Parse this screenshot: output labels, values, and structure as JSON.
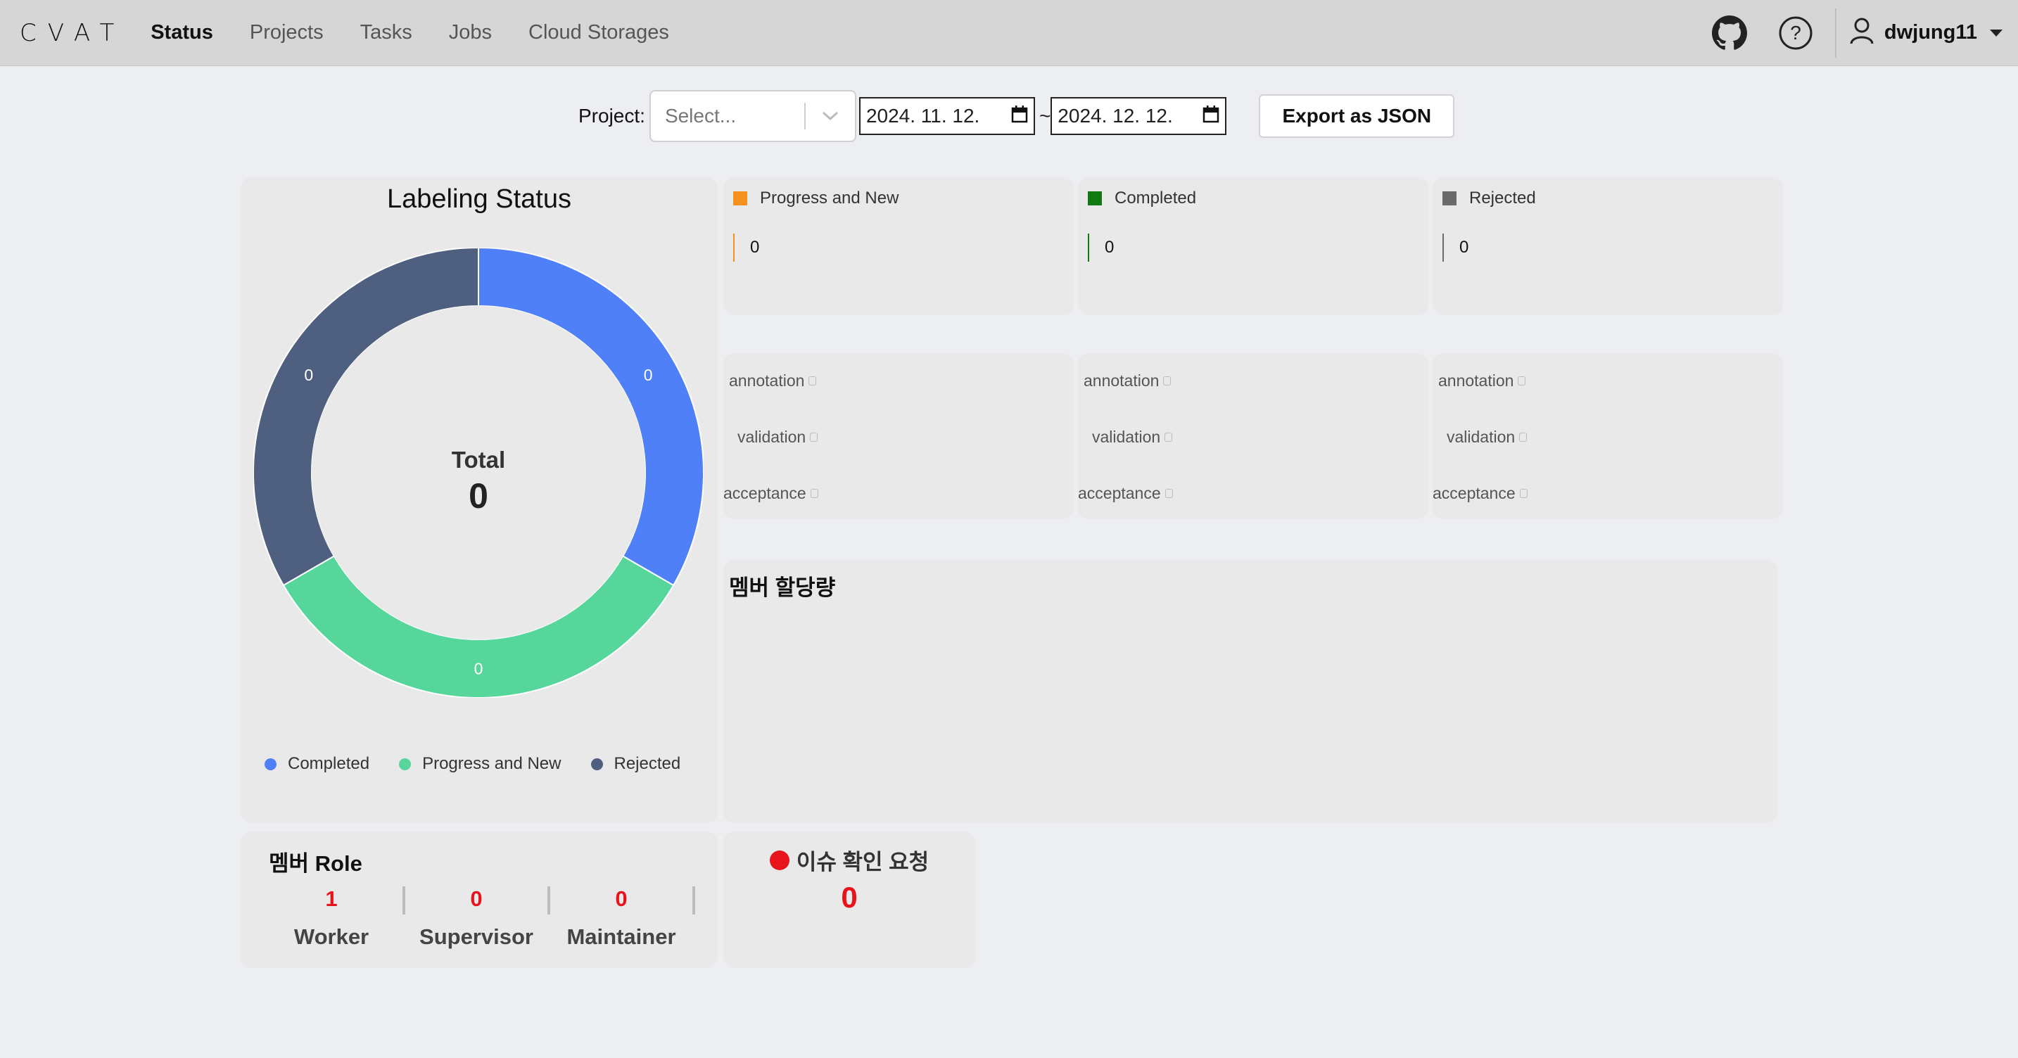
{
  "header": {
    "logo": "CVAT",
    "nav": [
      {
        "label": "Status",
        "active": true
      },
      {
        "label": "Projects",
        "active": false
      },
      {
        "label": "Tasks",
        "active": false
      },
      {
        "label": "Jobs",
        "active": false
      },
      {
        "label": "Cloud Storages",
        "active": false
      }
    ],
    "icons": [
      "github-icon",
      "help-icon",
      "user-icon"
    ],
    "username": "dwjung11"
  },
  "filter": {
    "project_label": "Project:",
    "project_placeholder": "Select...",
    "date_from": "2024. 11. 12.",
    "date_separator": "~",
    "date_to": "2024. 12. 12.",
    "export_label": "Export as JSON"
  },
  "labeling_status": {
    "title": "Labeling Status",
    "total_label": "Total",
    "total_value": "0",
    "segments": [
      {
        "name": "Completed",
        "value": "0",
        "color": "#5080f8"
      },
      {
        "name": "Progress and New",
        "value": "0",
        "color": "#56d69a"
      },
      {
        "name": "Rejected",
        "value": "0",
        "color": "#4f5f80"
      }
    ]
  },
  "stats": [
    {
      "label": "Progress and New",
      "value": "0",
      "color": "#f5921e"
    },
    {
      "label": "Completed",
      "value": "0",
      "color": "#127a12"
    },
    {
      "label": "Rejected",
      "value": "0",
      "color": "#6a6a6a"
    }
  ],
  "stages": {
    "annotation": "annotation",
    "validation": "validation",
    "acceptance": "acceptance"
  },
  "member_allocation": {
    "title": "멤버 할당량"
  },
  "member_role": {
    "title": "멤버 Role",
    "roles": [
      {
        "count": "1",
        "name": "Worker"
      },
      {
        "count": "0",
        "name": "Supervisor"
      },
      {
        "count": "0",
        "name": "Maintainer"
      }
    ]
  },
  "issue": {
    "title": "이슈 확인 요청",
    "count": "0",
    "color": "#e8141b"
  }
}
